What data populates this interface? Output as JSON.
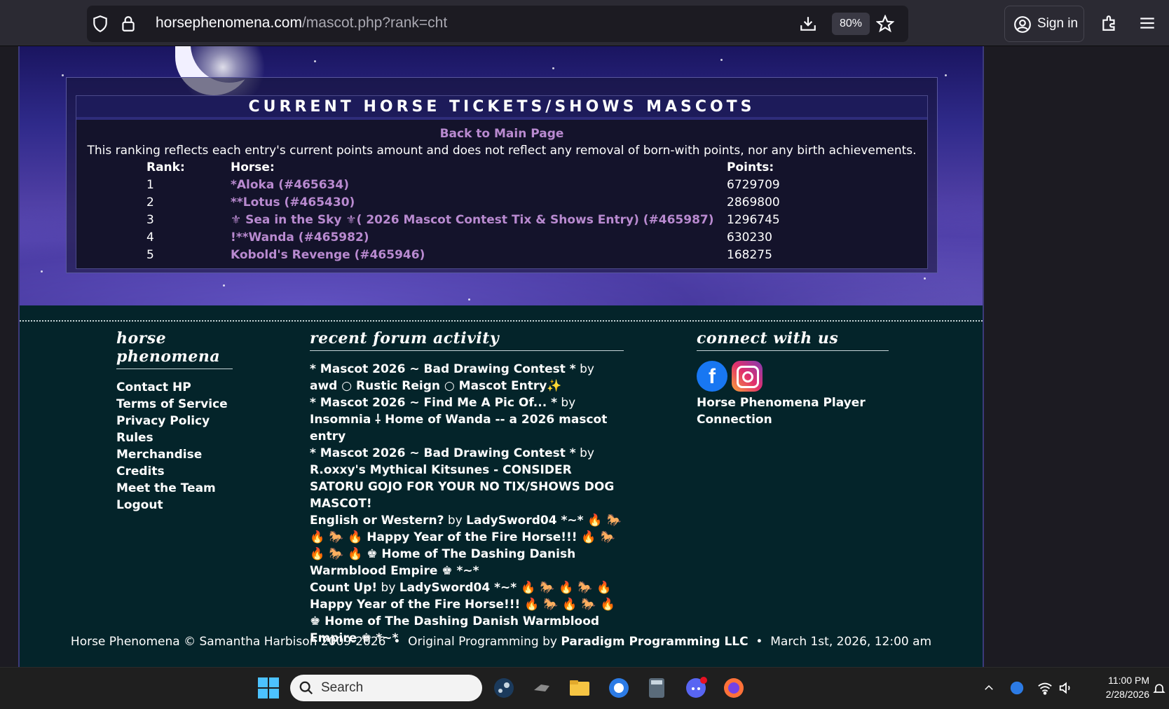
{
  "browser": {
    "url_host": "horsephenomena.com",
    "url_path": "/mascot.php?rank=cht",
    "zoom": "80%",
    "sign_in": "Sign in"
  },
  "ranking": {
    "title": "CURRENT HORSE TICKETS/SHOWS MASCOTS",
    "back_link": "Back to Main Page",
    "description": "This ranking reflects each entry's current points amount and does not reflect any removal of born-with points, nor any birth achievements.",
    "headers": {
      "rank": "Rank:",
      "horse": "Horse:",
      "points": "Points:"
    },
    "rows": [
      {
        "rank": "1",
        "horse": "*Aloka (#465634)",
        "points": "6729709"
      },
      {
        "rank": "2",
        "horse": "**Lotus (#465430)",
        "points": "2869800"
      },
      {
        "rank": "3",
        "horse": "⚜ Sea in the Sky ⚜( 2026 Mascot Contest Tix & Shows Entry) (#465987)",
        "points": "1296745"
      },
      {
        "rank": "4",
        "horse": "!**Wanda (#465982)",
        "points": "630230"
      },
      {
        "rank": "5",
        "horse": "Kobold's Revenge (#465946)",
        "points": "168275"
      }
    ]
  },
  "footer": {
    "hp": {
      "heading": "horse phenomena",
      "links": [
        "Contact HP",
        "Terms of Service",
        "Privacy Policy",
        "Rules",
        "Merchandise",
        "Credits",
        "Meet the Team",
        "Logout"
      ]
    },
    "forum": {
      "heading": "recent forum activity",
      "items": [
        {
          "topic": "* Mascot 2026 ~ Bad Drawing Contest *",
          "by": "by",
          "user": "awd ○ Rustic Reign ○ Mascot Entry✨"
        },
        {
          "topic": "* Mascot 2026 ~ Find Me A Pic Of... *",
          "by": "by",
          "user": "Insomnia ⸸ Home of Wanda -- a 2026 mascot entry"
        },
        {
          "topic": "* Mascot 2026 ~ Bad Drawing Contest *",
          "by": "by",
          "user": "R.oxxy's Mythical Kitsunes - CONSIDER SATORU GOJO FOR YOUR NO TIX/SHOWS DOG MASCOT!"
        },
        {
          "topic": "English or Western?",
          "by": "by",
          "user": "LadySword04 *~* 🔥 🐎 🔥 🐎 🔥 Happy Year of the Fire Horse!!! 🔥 🐎 🔥 🐎 🔥 ♚ Home of The Dashing Danish Warmblood Empire ♚ *~*"
        },
        {
          "topic": "Count Up!",
          "by": "by",
          "user": "LadySword04 *~* 🔥 🐎 🔥 🐎 🔥 Happy Year of the Fire Horse!!! 🔥 🐎 🔥 🐎 🔥 ♚ Home of The Dashing Danish Warmblood Empire ♚ *~*"
        }
      ]
    },
    "connect": {
      "heading": "connect with us",
      "facebook_icon": "facebook-icon",
      "instagram_icon": "instagram-icon",
      "player_link": "Horse Phenomena Player Connection"
    },
    "copyright_text": "Horse Phenomena © Samantha Harbison 2009-2026",
    "sep": "•",
    "programming_prefix": "Original Programming by",
    "programming_name": "Paradigm Programming LLC",
    "date_text": "March 1st, 2026, 12:00 am"
  },
  "taskbar": {
    "search_placeholder": "Search",
    "time": "11:00 PM",
    "date": "2/28/2026"
  }
}
